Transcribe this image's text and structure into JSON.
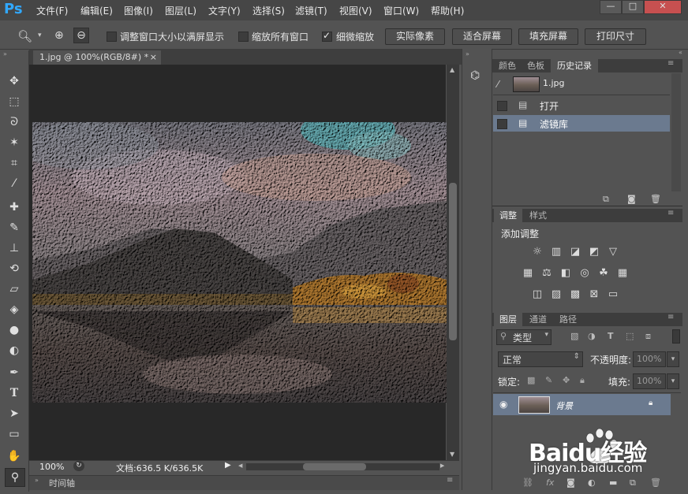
{
  "app": {
    "logo": "Ps"
  },
  "menu": [
    "文件(F)",
    "编辑(E)",
    "图像(I)",
    "图层(L)",
    "文字(Y)",
    "选择(S)",
    "滤镜(T)",
    "视图(V)",
    "窗口(W)",
    "帮助(H)"
  ],
  "window_controls": {
    "minimize": "—",
    "restore": "□",
    "close": "✕"
  },
  "options": {
    "resize_windows": "调整窗口大小以满屏显示",
    "zoom_all": "缩放所有窗口",
    "scrubby_zoom": "细微缩放",
    "btn_actual": "实际像素",
    "btn_fit": "适合屏幕",
    "btn_fill": "填充屏幕",
    "btn_print": "打印尺寸"
  },
  "document": {
    "tab": "1.jpg @ 100%(RGB/8#) *",
    "close": "×"
  },
  "status": {
    "zoom": "100%",
    "doc_info": "文档:636.5 K/636.5K"
  },
  "timeline": {
    "label": "时间轴"
  },
  "history_panel": {
    "tabs": [
      "颜色",
      "色板",
      "历史记录"
    ],
    "snapshot": "1.jpg",
    "items": [
      "打开",
      "滤镜库"
    ]
  },
  "adjust_panel": {
    "tabs": [
      "调整",
      "样式"
    ],
    "title": "添加调整"
  },
  "layers_panel": {
    "tabs": [
      "图层",
      "通道",
      "路径"
    ],
    "filter": "类型",
    "blend": "正常",
    "opacity_label": "不透明度:",
    "opacity": "100%",
    "lock_label": "锁定:",
    "fill_label": "填充:",
    "fill": "100%",
    "layer_name": "背景"
  },
  "watermark": {
    "brand": "Baidu经验",
    "url": "jingyan.baidu.com"
  }
}
